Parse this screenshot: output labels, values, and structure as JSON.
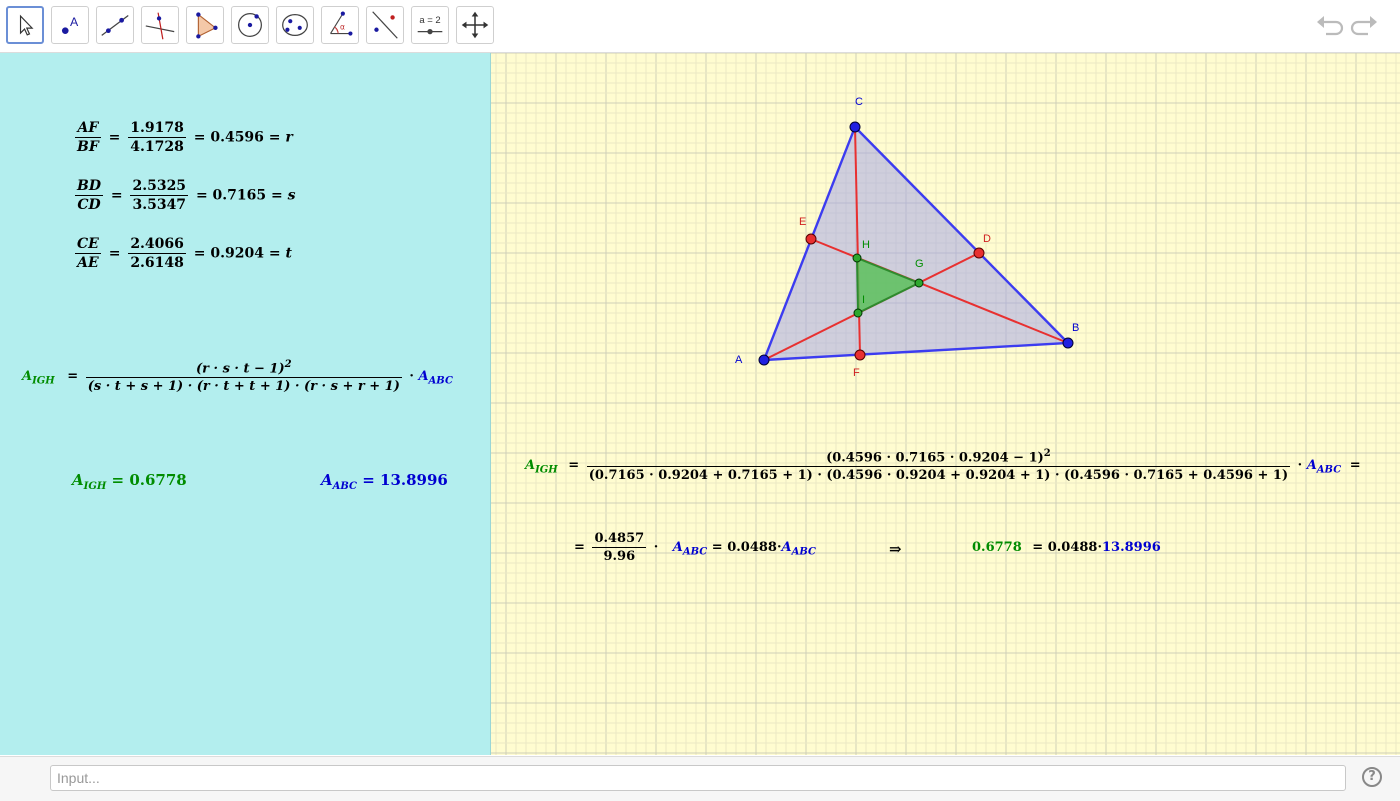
{
  "toolbar": {
    "tools": [
      {
        "name": "move-tool"
      },
      {
        "name": "point-tool",
        "label": "A"
      },
      {
        "name": "line-tool"
      },
      {
        "name": "perpendicular-line-tool"
      },
      {
        "name": "polygon-tool"
      },
      {
        "name": "circle-tool"
      },
      {
        "name": "conic-tool"
      },
      {
        "name": "angle-tool",
        "label": "α"
      },
      {
        "name": "reflect-tool"
      },
      {
        "name": "slider-tool",
        "label": "a = 2"
      },
      {
        "name": "move-graphics-view-tool"
      }
    ]
  },
  "algebra": {
    "r_eq": {
      "lhs_num": "AF",
      "lhs_den": "BF",
      "num": "1.9178",
      "den": "4.1728",
      "result": "= 0.4596 =",
      "var": "r"
    },
    "s_eq": {
      "lhs_num": "BD",
      "lhs_den": "CD",
      "num": "2.5325",
      "den": "3.5347",
      "result": "= 0.7165 =",
      "var": "s"
    },
    "t_eq": {
      "lhs_num": "CE",
      "lhs_den": "AE",
      "num": "2.4066",
      "den": "2.6148",
      "result": "= 0.9204 =",
      "var": "t"
    },
    "formula": {
      "lhs": "A",
      "lhs_sub": "IGH",
      "num": "(r · s · t − 1)",
      "den": "(s · t + s + 1) · (r · t + t + 1) · (r · s + r + 1)",
      "times": "·",
      "rhs": "A",
      "rhs_sub": "ABC"
    },
    "aigh": {
      "label": "A",
      "sub": "IGH",
      "value": "= 0.6778"
    },
    "aabc": {
      "label": "A",
      "sub": "ABC",
      "value": "= 13.8996"
    }
  },
  "graphics": {
    "points": {
      "A": "A",
      "B": "B",
      "C": "C",
      "D": "D",
      "E": "E",
      "F": "F",
      "G": "G",
      "H": "H",
      "I": "I"
    },
    "colors": {
      "triangle": "#3c3cf0",
      "cevian": "#e83030",
      "inner": "#2e8b2e",
      "fill": "#a8a8e6",
      "inner_fill": "#5cbf5c"
    },
    "calc1": {
      "lhs": "A",
      "lhs_sub": "IGH",
      "num": "(0.4596 · 0.7165 · 0.9204 − 1)",
      "den": "(0.7165 · 0.9204 + 0.7165 + 1) · (0.4596 · 0.9204 + 0.9204 + 1) · (0.4596 · 0.7165 + 0.4596 + 1)",
      "rhs": "A",
      "rhs_sub": "ABC"
    },
    "calc2": {
      "num": "0.4857",
      "den": "9.96",
      "rhs": "A",
      "rhs_sub": "ABC",
      "coef": "= 0.0488·",
      "arrow": "⇒",
      "green_val": "0.6778",
      "coef2": "= 0.0488·",
      "blue_val": "13.8996"
    }
  },
  "input": {
    "placeholder": "Input..."
  },
  "help": {
    "label": "?"
  }
}
